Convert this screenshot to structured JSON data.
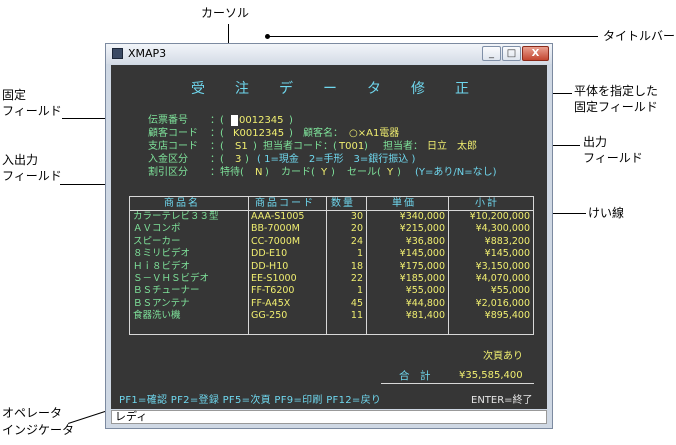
{
  "annotations": {
    "cursor": "カーソル",
    "titlebar": "タイトルバー",
    "fixed_field_1": "固定",
    "fixed_field_2": "フィールド",
    "flat_fixed_1": "平体を指定した",
    "flat_fixed_2": "固定フィールド",
    "input_output_1": "入出力",
    "input_output_2": "フィールド",
    "output_1": "出力",
    "output_2": "フィールド",
    "rule_line": "けい線",
    "operator_1": "オペレータ",
    "operator_2": "インジケータ"
  },
  "window": {
    "title": "XMAP3",
    "min": "_",
    "max": "□",
    "close": "X"
  },
  "screen": {
    "title": "受注データ修正",
    "line1": {
      "label": "伝票番号",
      "sep": "：(",
      "value": "0012345",
      "close": ")"
    },
    "line2": {
      "label": "顧客コード",
      "sep": "：(",
      "value": "K0012345",
      "close": ")",
      "label2": "顧客名：",
      "value2": "○×A1電器"
    },
    "line3": {
      "label": "支店コード",
      "sep": "：(",
      "value": "S1",
      "close": ")",
      "label2": "担当者コード：(",
      "value2": "T001",
      "close2": ")",
      "label3": "担当者：",
      "value3": "日立　太郎"
    },
    "line4": {
      "label": "入金区分",
      "sep": "：(",
      "value": "3",
      "close": ")",
      "options": "( 1=現金　2=手形　3=銀行振込 )"
    },
    "line5": {
      "label": "割引区分",
      "sep": "：特待(",
      "value": "N",
      "close": ")",
      "label2": "カード(",
      "value2": "Y",
      "close2": ")",
      "label3": "セール(",
      "value3": "Y",
      "close3": ")",
      "note": "(Y=あり/N=なし)"
    },
    "table": {
      "headers": [
        "商品名",
        "商品コード",
        "数量",
        "単価",
        "小計"
      ],
      "rows": [
        [
          "カラーテレビ３３型",
          "AAA-S1005",
          "30",
          "¥340,000",
          "¥10,200,000"
        ],
        [
          "ＡＶコンポ",
          "BB-7000M",
          "20",
          "¥215,000",
          "¥4,300,000"
        ],
        [
          "スピーカー",
          "CC-7000M",
          "24",
          "¥36,800",
          "¥883,200"
        ],
        [
          "８ミリビデオ",
          "DD-E10",
          "1",
          "¥145,000",
          "¥145,000"
        ],
        [
          "Ｈｉ８ビデオ",
          "DD-H10",
          "18",
          "¥175,000",
          "¥3,150,000"
        ],
        [
          "Ｓ－ＶＨＳビデオ",
          "EE-S1000",
          "22",
          "¥185,000",
          "¥4,070,000"
        ],
        [
          "ＢＳチューナー",
          "FF-T6200",
          "1",
          "¥55,000",
          "¥55,000"
        ],
        [
          "ＢＳアンテナ",
          "FF-A45X",
          "45",
          "¥44,800",
          "¥2,016,000"
        ],
        [
          "食器洗い機",
          "GG-250",
          "11",
          "¥81,400",
          "¥895,400"
        ]
      ]
    },
    "next_page": "次頁あり",
    "total_label": "合　計",
    "total_value": "¥35,585,400",
    "function_keys": "PF1=確認 PF2=登録 PF5=次頁 PF9=印刷 PF12=戻り",
    "enter_key": "ENTER=終了"
  },
  "status": {
    "text": "レディ"
  }
}
